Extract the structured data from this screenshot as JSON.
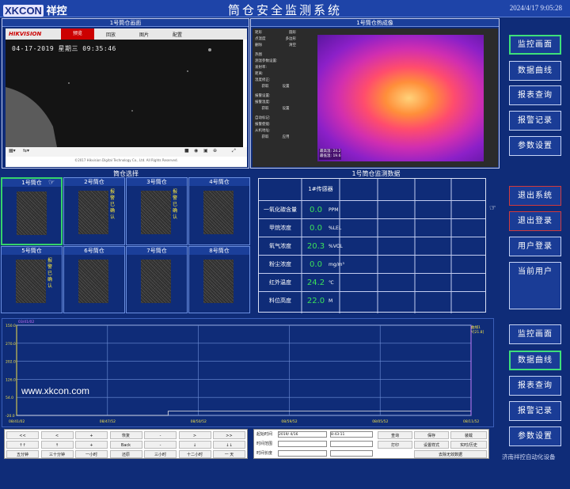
{
  "header": {
    "logo_a": "XKCON",
    "logo_b": "祥控",
    "title": "筒仓安全监测系统",
    "clock": "2024/4/17 9:05:28"
  },
  "video": {
    "title": "1号筒仓画面",
    "brand": "HIKVISION",
    "tabs": [
      "预览",
      "回放",
      "图片",
      "配置"
    ],
    "timestamp": "04-17-2019 星期三 09:35:46",
    "copyright": "©2017 Hikvision Digital Technology Co., Ltd. All Rights Reserved."
  },
  "thermal": {
    "title": "1号筒仓热成像",
    "menu": [
      "矩形",
      "圆形",
      "点温度",
      "多边形",
      "删除",
      "清空",
      "热图",
      "测温参数设置:",
      "发射率:",
      "距离:",
      "温度修正:",
      "获取",
      "设置",
      "报警设置:",
      "报警温度:",
      "获取",
      "设置",
      "自动标记:",
      "报警使能:",
      "从机地址:",
      "获取",
      "应用"
    ],
    "stats": [
      "最高温: 24.2",
      "最低温: 19.6"
    ]
  },
  "side_top": [
    "监控画面",
    "数据曲线",
    "报表查询",
    "报警记录",
    "参数设置"
  ],
  "side_mid": [
    "退出系统",
    "退出登录",
    "用户登录",
    "当前用户"
  ],
  "side_bottom": [
    "监控画面",
    "数据曲线",
    "报表查询",
    "报警记录",
    "参数设置"
  ],
  "silos": {
    "title": "筒仓选择",
    "items": [
      {
        "name": "1号筒仓",
        "alarm": ""
      },
      {
        "name": "2号筒仓",
        "alarm": "报警已确认"
      },
      {
        "name": "3号筒仓",
        "alarm": "报警已确认"
      },
      {
        "name": "4号筒仓",
        "alarm": ""
      },
      {
        "name": "5号筒仓",
        "alarm": "报警已确认"
      },
      {
        "name": "6号筒仓",
        "alarm": ""
      },
      {
        "name": "7号筒仓",
        "alarm": ""
      },
      {
        "name": "8号筒仓",
        "alarm": ""
      }
    ]
  },
  "monitor": {
    "title": "1号筒仓监测数据",
    "header": "1#传感器",
    "rows": [
      {
        "label": "一氧化碳含量",
        "value": "0.0",
        "unit": "PPM"
      },
      {
        "label": "甲烷浓度",
        "value": "0.0",
        "unit": "%LEL"
      },
      {
        "label": "氧气浓度",
        "value": "20.3",
        "unit": "%VOL"
      },
      {
        "label": "粉尘浓度",
        "value": "0.0",
        "unit": "mg/m³"
      },
      {
        "label": "红外温度",
        "value": "24.2",
        "unit": "℃"
      },
      {
        "label": "料位高度",
        "value": "22.0",
        "unit": "M"
      }
    ]
  },
  "chart_data": {
    "type": "line",
    "yticks": [
      "150.0",
      "270.0",
      "202.0",
      "126.0",
      "54.0",
      "-20.0"
    ],
    "ytop_label": "03/41/02",
    "xticks": [
      "08/41/02",
      "08/47/52",
      "08/50/52",
      "08/59/52",
      "08/05/52",
      "08/11/52"
    ],
    "watermark": "www.xkcon.com",
    "legend": [
      "曲线1",
      "Y[21.8]"
    ],
    "series": [
      {
        "values": [
          -20,
          -20,
          -20,
          -5,
          -5,
          -5,
          -5,
          -5,
          -5,
          -5
        ]
      }
    ],
    "ylim": [
      -20,
      300
    ]
  },
  "controls": {
    "row1": [
      "<<",
      "<",
      "+",
      "恢复",
      "-",
      ">",
      ">>"
    ],
    "row2": [
      "↑↑",
      "↑",
      "+",
      "Back",
      "-",
      "↓",
      "↓↓"
    ],
    "row3": [
      "五分钟",
      "三十分钟",
      "一小时",
      "还原",
      "三小时",
      "十二小时",
      "一 天"
    ],
    "start_label": "起始时间",
    "start_value": "2019/ 4/16",
    "start_time": "8:43:11",
    "span_label": "时间范围",
    "length_label": "时间长度",
    "btns": [
      "查询",
      "保存",
      "装载",
      "打印",
      "设置样式",
      "实时/历史"
    ],
    "clear": "去除无效数据"
  },
  "footer": "济南祥控自动化设备"
}
